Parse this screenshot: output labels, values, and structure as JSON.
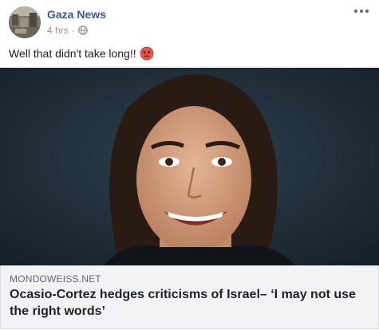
{
  "post": {
    "author": "Gaza News",
    "time": "4 hrs",
    "separator": "·",
    "privacy_icon": "globe-icon",
    "more_icon": "more-options-icon",
    "message": "Well that didn't take long!!",
    "emoji_icon": "angry-face-emoji-icon"
  },
  "link": {
    "domain": "MONDOWEISS.NET",
    "headline": "Ocasio-Cortez hedges criticisms of Israel– ‘I may not use the right words’"
  },
  "colors": {
    "author": "#385898",
    "meta": "#90949c",
    "link_bg": "#f2f3f5"
  }
}
